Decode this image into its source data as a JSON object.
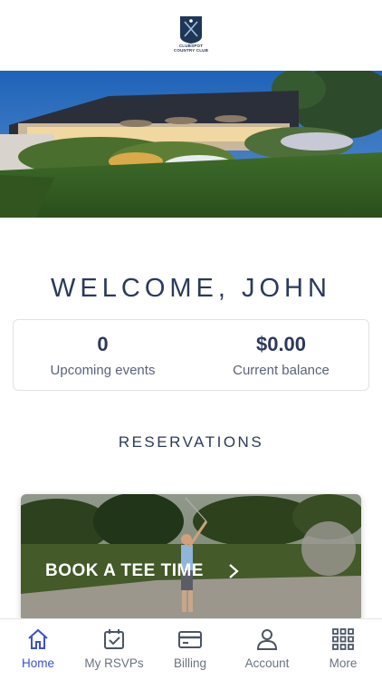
{
  "header": {
    "logo_line1": "CLUBSPOT",
    "logo_line2": "COUNTRY CLUB"
  },
  "welcome": {
    "text": "WELCOME, JOHN"
  },
  "stats": {
    "upcoming_value": "0",
    "upcoming_label": "Upcoming events",
    "balance_value": "$0.00",
    "balance_label": "Current balance"
  },
  "reservations": {
    "title": "RESERVATIONS",
    "card_label": "BOOK A TEE TIME"
  },
  "tabbar": {
    "items": [
      {
        "label": "Home",
        "icon": "home-icon",
        "active": true
      },
      {
        "label": "My RSVPs",
        "icon": "calendar-check-icon",
        "active": false
      },
      {
        "label": "Billing",
        "icon": "credit-card-icon",
        "active": false
      },
      {
        "label": "Account",
        "icon": "user-icon",
        "active": false
      },
      {
        "label": "More",
        "icon": "grid-icon",
        "active": false
      }
    ]
  },
  "colors": {
    "primary_text": "#2b3a5c",
    "accent": "#3b4fd8",
    "inactive_tab": "#6b7280"
  }
}
